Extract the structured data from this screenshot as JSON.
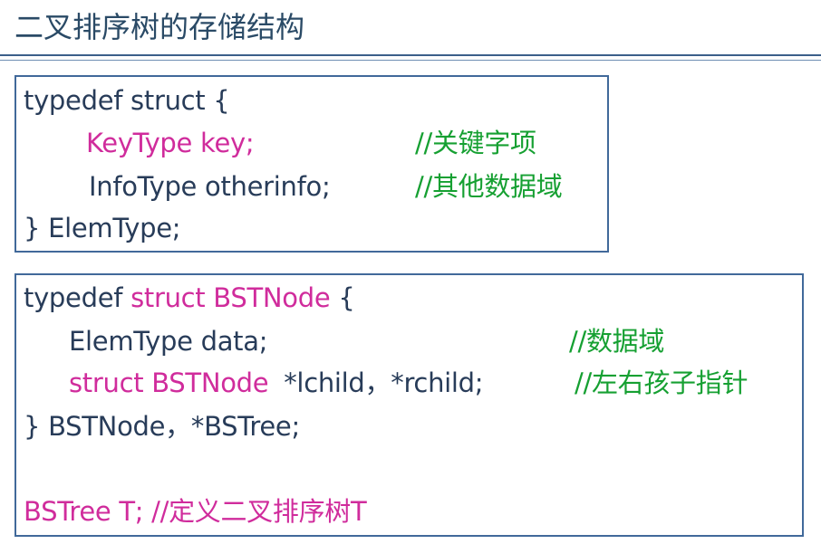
{
  "title": "二叉排序树的存储结构",
  "elem_type_block": {
    "line1": "typedef struct {",
    "key_decl": "KeyType key;",
    "key_comment": "//关键字项",
    "info_decl": "InfoType otherinfo;",
    "info_comment": "//其他数据域",
    "closing": "} ElemType;"
  },
  "bstnode_block": {
    "typedef_kw": "typedef",
    "struct_name": "struct BSTNode",
    "open_brace": "{",
    "data_decl": "ElemType  data;",
    "data_comment": "//数据域",
    "child_type": "struct BSTNode",
    "child_vars": "*lchild，*rchild;",
    "child_comment": "//左右孩子指针",
    "closing": "}  BSTNode，*BSTree;",
    "tree_decl": "BSTree T;",
    "tree_comment": "//定义二叉排序树T"
  },
  "colors": {
    "title": "#2a4a66",
    "code_default": "#283c59",
    "code_keyword": "#d02c9c",
    "comment": "#16a032",
    "border": "#41699a"
  }
}
